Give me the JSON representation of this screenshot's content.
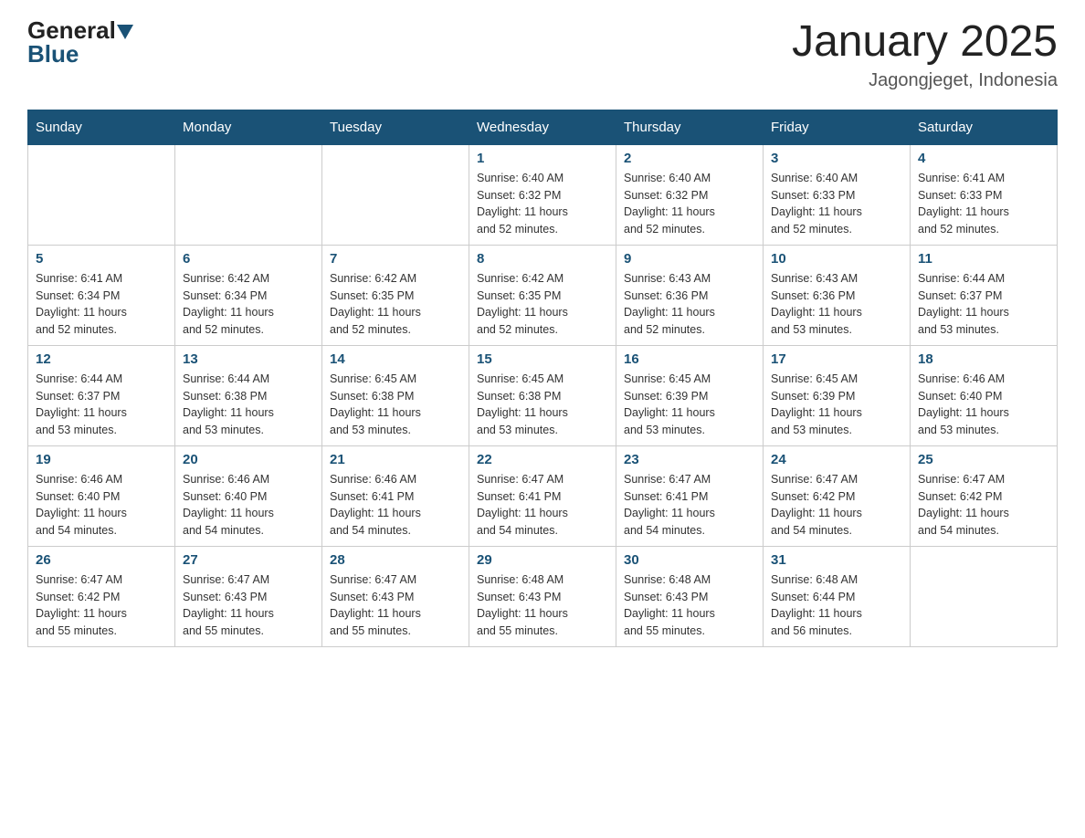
{
  "header": {
    "logo": {
      "general": "General",
      "blue": "Blue"
    },
    "title": "January 2025",
    "location": "Jagongjeget, Indonesia"
  },
  "days_of_week": [
    "Sunday",
    "Monday",
    "Tuesday",
    "Wednesday",
    "Thursday",
    "Friday",
    "Saturday"
  ],
  "weeks": [
    [
      {
        "day": "",
        "info": ""
      },
      {
        "day": "",
        "info": ""
      },
      {
        "day": "",
        "info": ""
      },
      {
        "day": "1",
        "info": "Sunrise: 6:40 AM\nSunset: 6:32 PM\nDaylight: 11 hours\nand 52 minutes."
      },
      {
        "day": "2",
        "info": "Sunrise: 6:40 AM\nSunset: 6:32 PM\nDaylight: 11 hours\nand 52 minutes."
      },
      {
        "day": "3",
        "info": "Sunrise: 6:40 AM\nSunset: 6:33 PM\nDaylight: 11 hours\nand 52 minutes."
      },
      {
        "day": "4",
        "info": "Sunrise: 6:41 AM\nSunset: 6:33 PM\nDaylight: 11 hours\nand 52 minutes."
      }
    ],
    [
      {
        "day": "5",
        "info": "Sunrise: 6:41 AM\nSunset: 6:34 PM\nDaylight: 11 hours\nand 52 minutes."
      },
      {
        "day": "6",
        "info": "Sunrise: 6:42 AM\nSunset: 6:34 PM\nDaylight: 11 hours\nand 52 minutes."
      },
      {
        "day": "7",
        "info": "Sunrise: 6:42 AM\nSunset: 6:35 PM\nDaylight: 11 hours\nand 52 minutes."
      },
      {
        "day": "8",
        "info": "Sunrise: 6:42 AM\nSunset: 6:35 PM\nDaylight: 11 hours\nand 52 minutes."
      },
      {
        "day": "9",
        "info": "Sunrise: 6:43 AM\nSunset: 6:36 PM\nDaylight: 11 hours\nand 52 minutes."
      },
      {
        "day": "10",
        "info": "Sunrise: 6:43 AM\nSunset: 6:36 PM\nDaylight: 11 hours\nand 53 minutes."
      },
      {
        "day": "11",
        "info": "Sunrise: 6:44 AM\nSunset: 6:37 PM\nDaylight: 11 hours\nand 53 minutes."
      }
    ],
    [
      {
        "day": "12",
        "info": "Sunrise: 6:44 AM\nSunset: 6:37 PM\nDaylight: 11 hours\nand 53 minutes."
      },
      {
        "day": "13",
        "info": "Sunrise: 6:44 AM\nSunset: 6:38 PM\nDaylight: 11 hours\nand 53 minutes."
      },
      {
        "day": "14",
        "info": "Sunrise: 6:45 AM\nSunset: 6:38 PM\nDaylight: 11 hours\nand 53 minutes."
      },
      {
        "day": "15",
        "info": "Sunrise: 6:45 AM\nSunset: 6:38 PM\nDaylight: 11 hours\nand 53 minutes."
      },
      {
        "day": "16",
        "info": "Sunrise: 6:45 AM\nSunset: 6:39 PM\nDaylight: 11 hours\nand 53 minutes."
      },
      {
        "day": "17",
        "info": "Sunrise: 6:45 AM\nSunset: 6:39 PM\nDaylight: 11 hours\nand 53 minutes."
      },
      {
        "day": "18",
        "info": "Sunrise: 6:46 AM\nSunset: 6:40 PM\nDaylight: 11 hours\nand 53 minutes."
      }
    ],
    [
      {
        "day": "19",
        "info": "Sunrise: 6:46 AM\nSunset: 6:40 PM\nDaylight: 11 hours\nand 54 minutes."
      },
      {
        "day": "20",
        "info": "Sunrise: 6:46 AM\nSunset: 6:40 PM\nDaylight: 11 hours\nand 54 minutes."
      },
      {
        "day": "21",
        "info": "Sunrise: 6:46 AM\nSunset: 6:41 PM\nDaylight: 11 hours\nand 54 minutes."
      },
      {
        "day": "22",
        "info": "Sunrise: 6:47 AM\nSunset: 6:41 PM\nDaylight: 11 hours\nand 54 minutes."
      },
      {
        "day": "23",
        "info": "Sunrise: 6:47 AM\nSunset: 6:41 PM\nDaylight: 11 hours\nand 54 minutes."
      },
      {
        "day": "24",
        "info": "Sunrise: 6:47 AM\nSunset: 6:42 PM\nDaylight: 11 hours\nand 54 minutes."
      },
      {
        "day": "25",
        "info": "Sunrise: 6:47 AM\nSunset: 6:42 PM\nDaylight: 11 hours\nand 54 minutes."
      }
    ],
    [
      {
        "day": "26",
        "info": "Sunrise: 6:47 AM\nSunset: 6:42 PM\nDaylight: 11 hours\nand 55 minutes."
      },
      {
        "day": "27",
        "info": "Sunrise: 6:47 AM\nSunset: 6:43 PM\nDaylight: 11 hours\nand 55 minutes."
      },
      {
        "day": "28",
        "info": "Sunrise: 6:47 AM\nSunset: 6:43 PM\nDaylight: 11 hours\nand 55 minutes."
      },
      {
        "day": "29",
        "info": "Sunrise: 6:48 AM\nSunset: 6:43 PM\nDaylight: 11 hours\nand 55 minutes."
      },
      {
        "day": "30",
        "info": "Sunrise: 6:48 AM\nSunset: 6:43 PM\nDaylight: 11 hours\nand 55 minutes."
      },
      {
        "day": "31",
        "info": "Sunrise: 6:48 AM\nSunset: 6:44 PM\nDaylight: 11 hours\nand 56 minutes."
      },
      {
        "day": "",
        "info": ""
      }
    ]
  ]
}
